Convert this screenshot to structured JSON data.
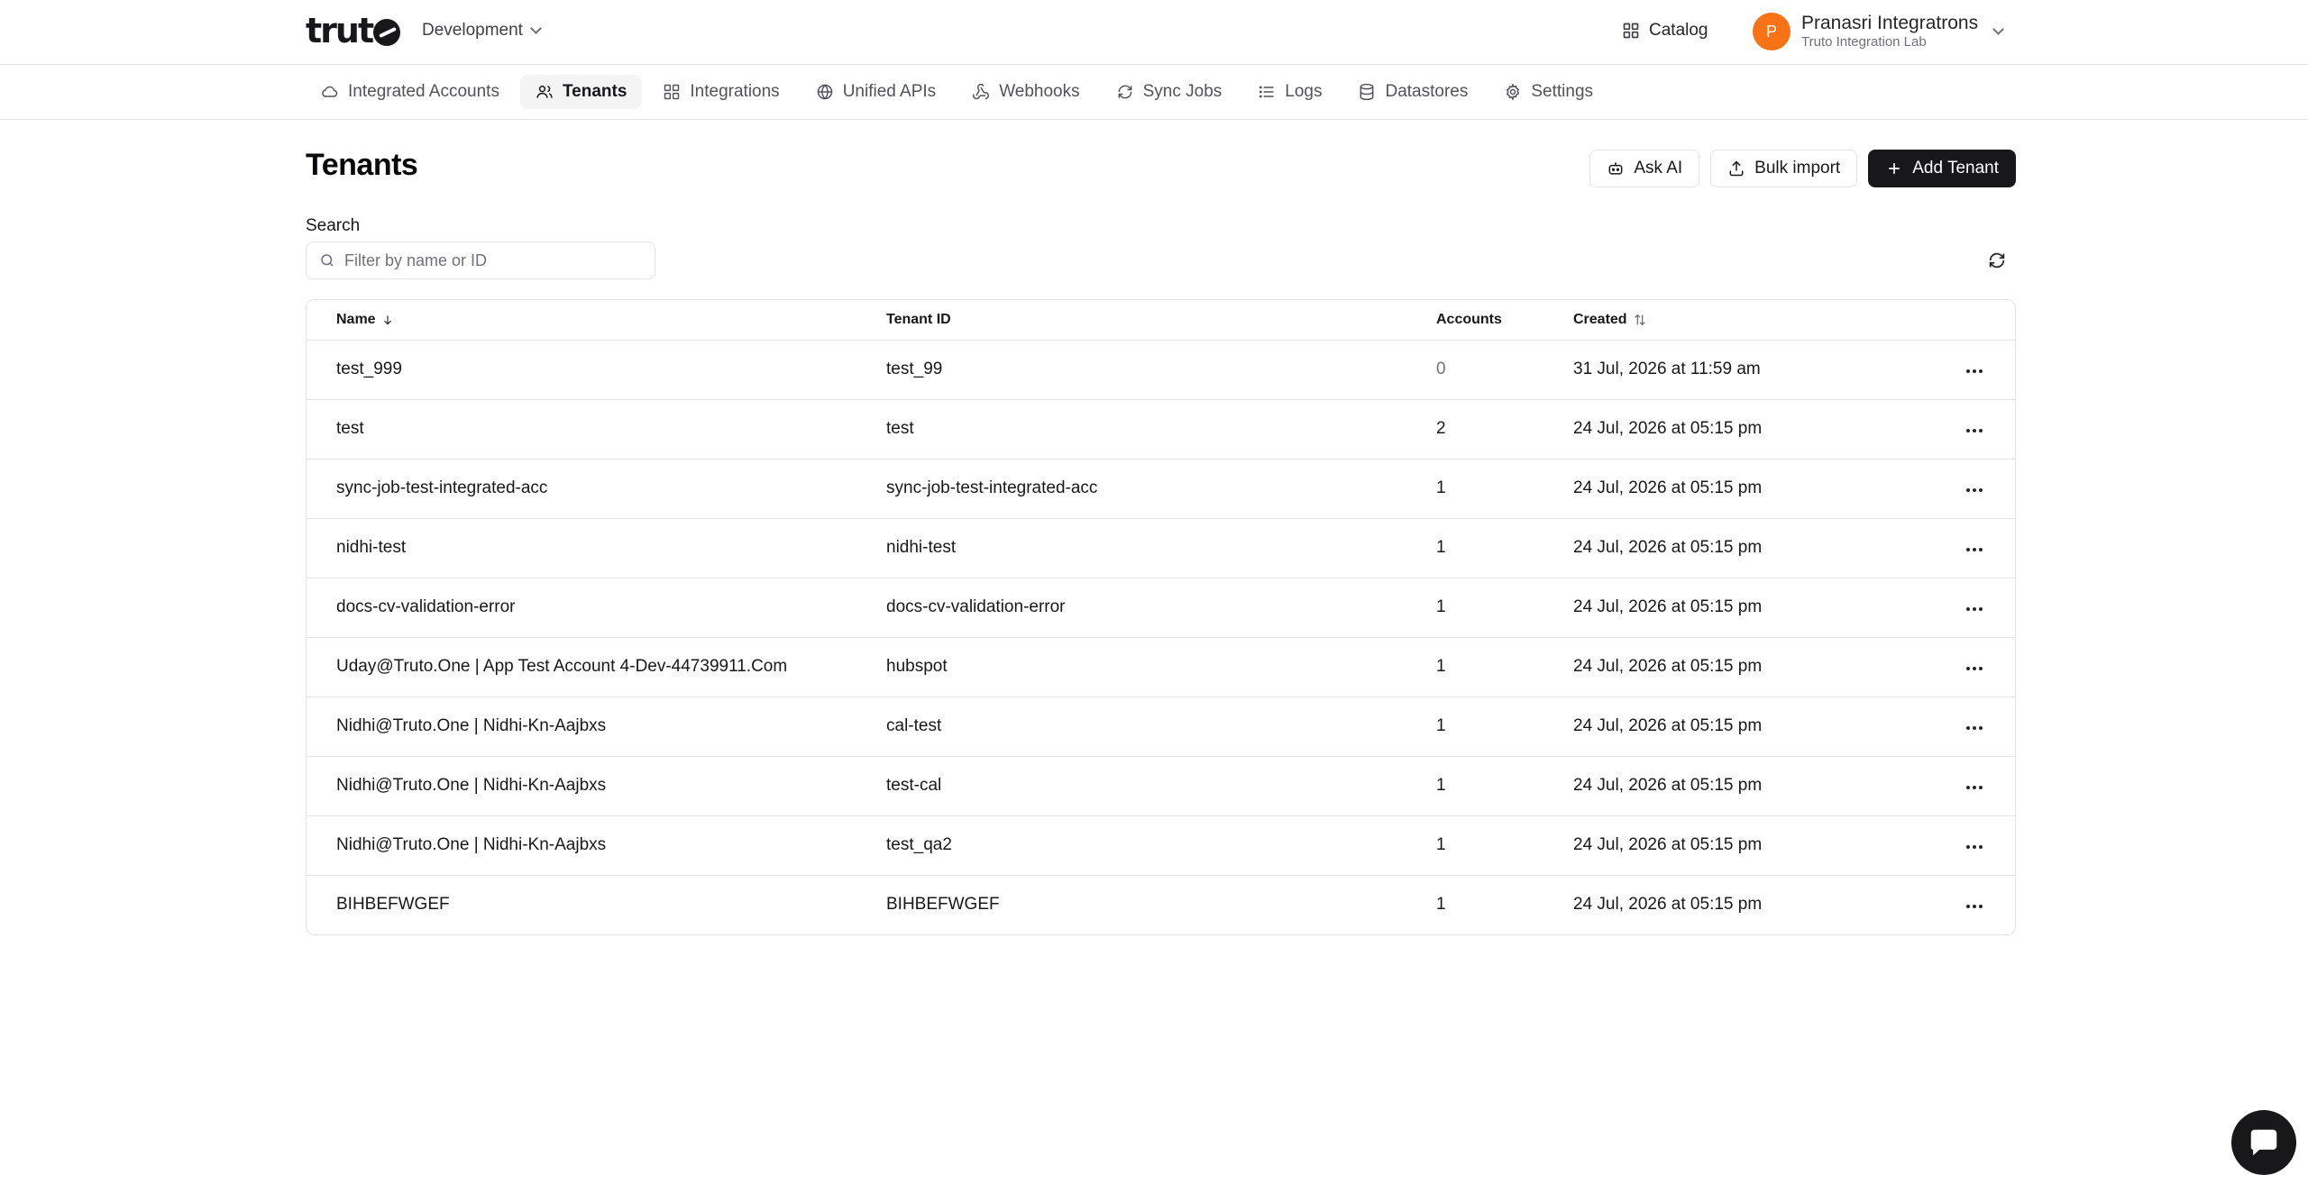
{
  "header": {
    "logo_text": "trut",
    "environment": "Development",
    "catalog_label": "Catalog",
    "user": {
      "initial": "P",
      "name": "Pranasri Integratrons",
      "org": "Truto Integration Lab"
    }
  },
  "nav": {
    "tabs": [
      {
        "label": "Integrated Accounts",
        "icon": "cloud-icon",
        "active": false
      },
      {
        "label": "Tenants",
        "icon": "users-icon",
        "active": true
      },
      {
        "label": "Integrations",
        "icon": "grid-icon",
        "active": false
      },
      {
        "label": "Unified APIs",
        "icon": "globe-icon",
        "active": false
      },
      {
        "label": "Webhooks",
        "icon": "webhook-icon",
        "active": false
      },
      {
        "label": "Sync Jobs",
        "icon": "sync-icon",
        "active": false
      },
      {
        "label": "Logs",
        "icon": "list-icon",
        "active": false
      },
      {
        "label": "Datastores",
        "icon": "database-icon",
        "active": false
      },
      {
        "label": "Settings",
        "icon": "gear-icon",
        "active": false
      }
    ]
  },
  "page": {
    "title": "Tenants",
    "ask_ai_label": "Ask AI",
    "bulk_import_label": "Bulk import",
    "add_tenant_label": "Add Tenant"
  },
  "search": {
    "label": "Search",
    "placeholder": "Filter by name or ID",
    "value": ""
  },
  "table": {
    "columns": {
      "name": "Name",
      "tenant_id": "Tenant ID",
      "accounts": "Accounts",
      "created": "Created"
    },
    "rows": [
      {
        "name": "test_999",
        "tenant_id": "test_99",
        "accounts": "0",
        "created": "31 Jul, 2026 at 11:59 am"
      },
      {
        "name": "test",
        "tenant_id": "test",
        "accounts": "2",
        "created": "24 Jul, 2026 at 05:15 pm"
      },
      {
        "name": "sync-job-test-integrated-acc",
        "tenant_id": "sync-job-test-integrated-acc",
        "accounts": "1",
        "created": "24 Jul, 2026 at 05:15 pm"
      },
      {
        "name": "nidhi-test",
        "tenant_id": "nidhi-test",
        "accounts": "1",
        "created": "24 Jul, 2026 at 05:15 pm"
      },
      {
        "name": "docs-cv-validation-error",
        "tenant_id": "docs-cv-validation-error",
        "accounts": "1",
        "created": "24 Jul, 2026 at 05:15 pm"
      },
      {
        "name": "Uday@Truto.One | App Test Account 4-Dev-44739911.Com",
        "tenant_id": "hubspot",
        "accounts": "1",
        "created": "24 Jul, 2026 at 05:15 pm"
      },
      {
        "name": "Nidhi@Truto.One | Nidhi-Kn-Aajbxs",
        "tenant_id": "cal-test",
        "accounts": "1",
        "created": "24 Jul, 2026 at 05:15 pm"
      },
      {
        "name": "Nidhi@Truto.One | Nidhi-Kn-Aajbxs",
        "tenant_id": "test-cal",
        "accounts": "1",
        "created": "24 Jul, 2026 at 05:15 pm"
      },
      {
        "name": "Nidhi@Truto.One | Nidhi-Kn-Aajbxs",
        "tenant_id": "test_qa2",
        "accounts": "1",
        "created": "24 Jul, 2026 at 05:15 pm"
      },
      {
        "name": "BIHBEFWGEF",
        "tenant_id": "BIHBEFWGEF",
        "accounts": "1",
        "created": "24 Jul, 2026 at 05:15 pm"
      }
    ]
  },
  "colors": {
    "accent_dark": "#18181b",
    "avatar": "#f97316",
    "border": "#e4e4e7",
    "muted": "#71717a"
  }
}
